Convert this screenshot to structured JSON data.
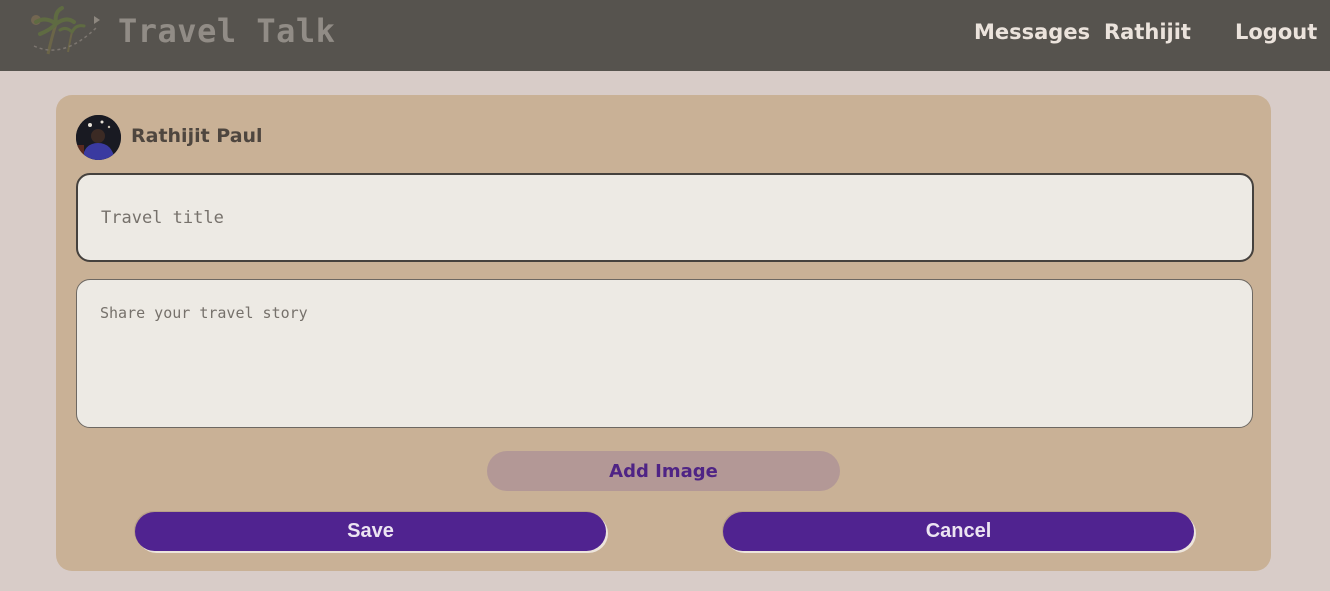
{
  "header": {
    "brand": "Travel Talk",
    "logo_icon": "palm-tree-logo-icon",
    "nav": [
      "Messages",
      "Rathijit",
      "Logout"
    ]
  },
  "post_form": {
    "user_name": "Rathijit Paul",
    "avatar_icon": "user-avatar",
    "title_placeholder": "Travel title",
    "title_value": "",
    "story_placeholder": "Share your travel story",
    "story_value": "",
    "add_image_label": "Add Image",
    "save_label": "Save",
    "cancel_label": "Cancel"
  },
  "colors": {
    "navbar": "#56534e",
    "page_background": "#d8ccc8",
    "card": "#c9b196",
    "primary_button": "#502390",
    "add_image_button": "#b39896"
  }
}
